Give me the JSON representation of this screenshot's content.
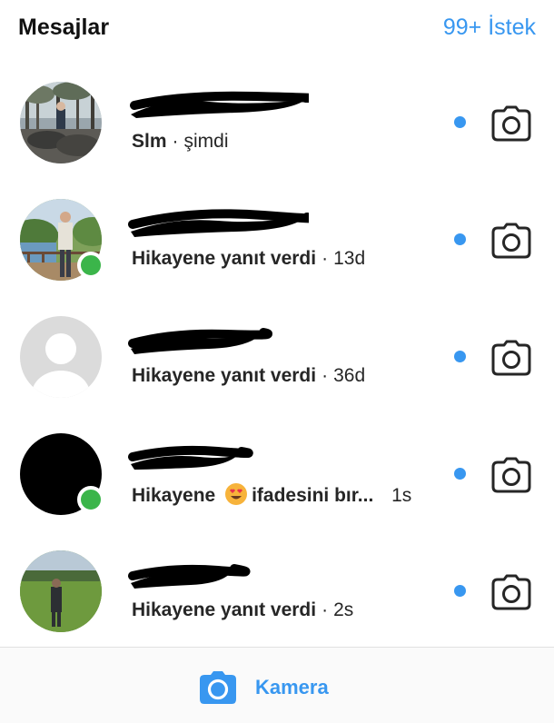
{
  "header": {
    "title": "Mesajlar",
    "requests_label": "99+ İstek"
  },
  "conversations": [
    {
      "message": "Slm",
      "separator": "·",
      "time": "şimdi",
      "unread": true,
      "online": false,
      "avatar": "photo-outdoor-trees"
    },
    {
      "message": "Hikayene yanıt verdi",
      "separator": "·",
      "time": "13d",
      "unread": true,
      "online": true,
      "avatar": "photo-man-garden"
    },
    {
      "message": "Hikayene yanıt verdi",
      "separator": "·",
      "time": "36d",
      "unread": true,
      "online": false,
      "avatar": "default-profile-placeholder"
    },
    {
      "message_before": "Hikayene",
      "emoji": "heart-eyes-emoji",
      "message_after": "ifadesini bır...",
      "time": "1s",
      "unread": true,
      "online": true,
      "avatar": "black-avatar"
    },
    {
      "message": "Hikayene yanıt verdi",
      "separator": "·",
      "time": "2s",
      "unread": true,
      "online": false,
      "avatar": "photo-man-field"
    }
  ],
  "bottom_bar": {
    "camera_label": "Kamera"
  },
  "colors": {
    "accent_blue": "#3897f0",
    "online_green": "#3bb54a",
    "text": "#262626"
  }
}
